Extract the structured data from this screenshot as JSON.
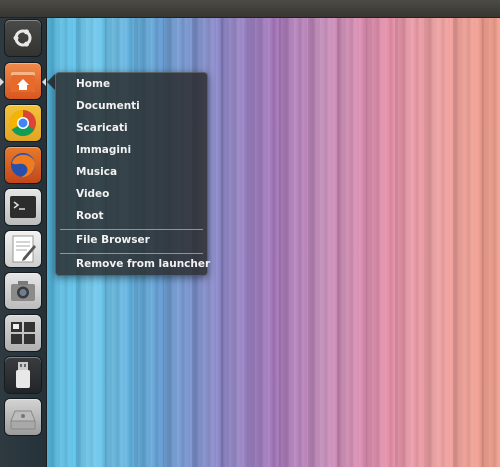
{
  "launcher": {
    "items": [
      {
        "name": "dash-button",
        "icon": "ubuntu-logo-icon"
      },
      {
        "name": "home-folder",
        "icon": "home-folder-icon"
      },
      {
        "name": "chrome",
        "icon": "chrome-icon"
      },
      {
        "name": "firefox",
        "icon": "firefox-icon"
      },
      {
        "name": "terminal",
        "icon": "terminal-icon"
      },
      {
        "name": "text-editor",
        "icon": "text-editor-icon"
      },
      {
        "name": "screenshot",
        "icon": "camera-icon"
      },
      {
        "name": "workspace-switcher",
        "icon": "workspaces-icon"
      },
      {
        "name": "usb-drive",
        "icon": "usb-drive-icon"
      },
      {
        "name": "trash",
        "icon": "trash-icon"
      }
    ]
  },
  "quicklist": {
    "items": [
      "Home",
      "Documenti",
      "Scaricati",
      "Immagini",
      "Musica",
      "Video",
      "Root"
    ],
    "file_browser": "File Browser",
    "remove": "Remove from launcher"
  },
  "colors": {
    "menu_bg": "#282828",
    "launcher_bg": "#2a363d"
  }
}
